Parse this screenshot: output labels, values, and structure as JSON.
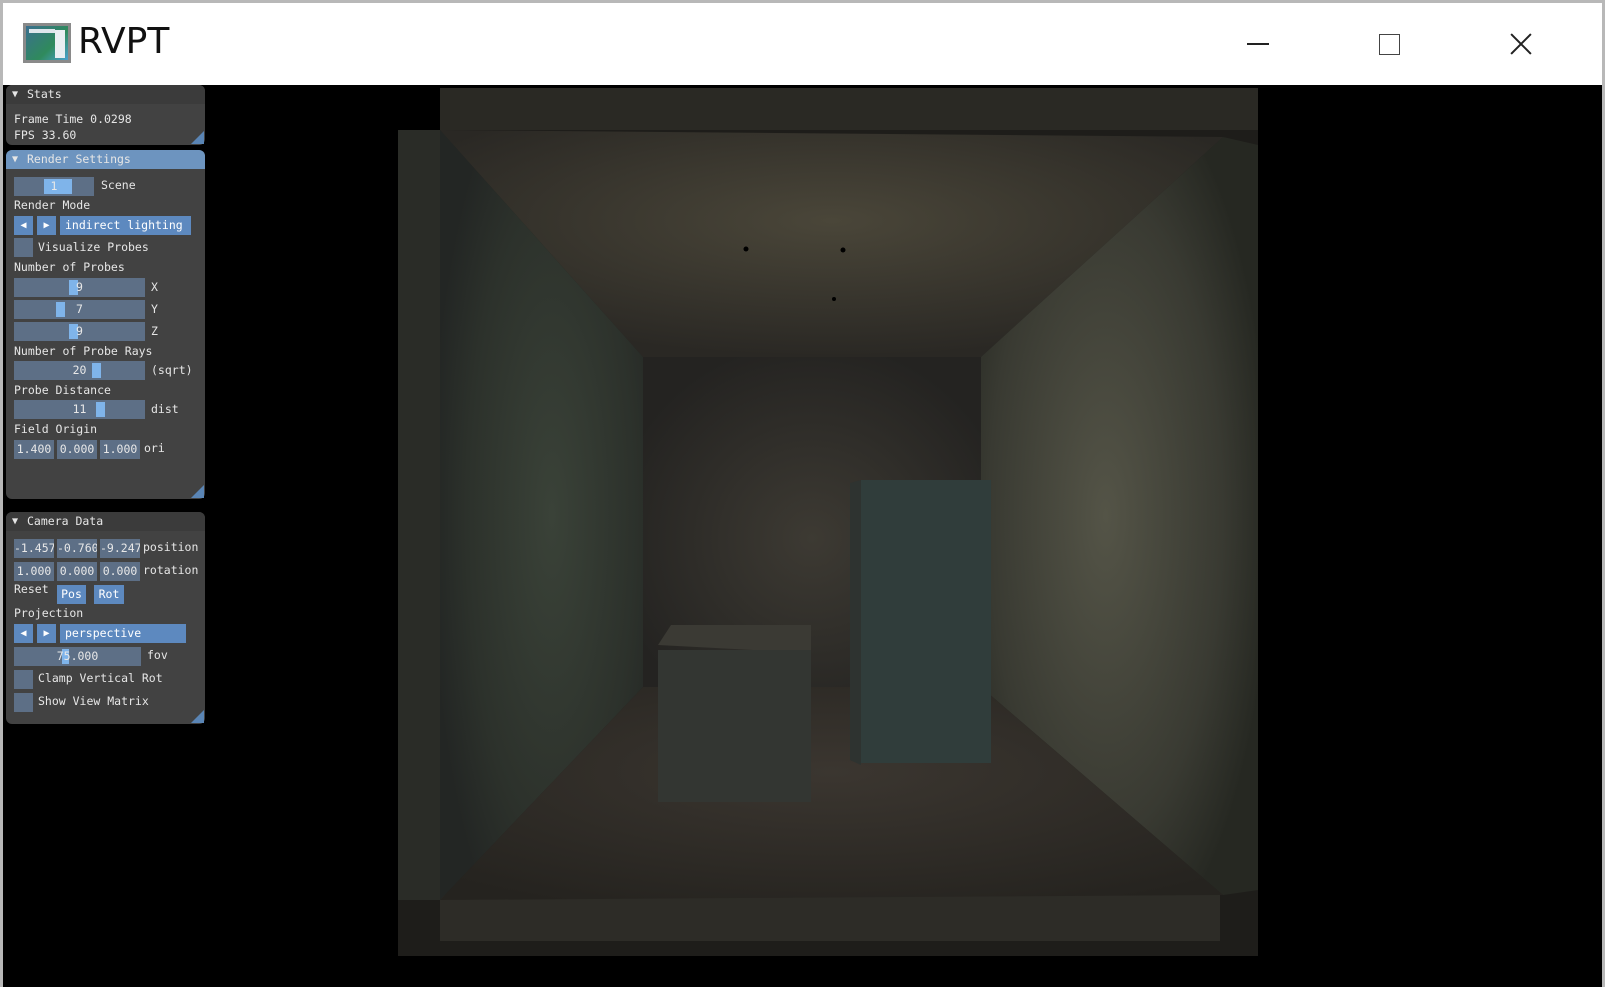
{
  "window": {
    "title": "RVPT",
    "icon": "app-window-icon"
  },
  "stats": {
    "header": "Stats",
    "frame_time": "Frame Time 0.0298",
    "fps": "FPS 33.60"
  },
  "render_settings": {
    "header": "Render Settings",
    "scene_value": "1",
    "scene_label": "Scene",
    "render_mode_label": "Render Mode",
    "render_mode_value": "indirect lighting",
    "visualize_probes_label": "Visualize Probes",
    "visualize_probes_checked": false,
    "num_probes_label": "Number of Probes",
    "probes_x": "9",
    "probes_x_label": "X",
    "probes_y": "7",
    "probes_y_label": "Y",
    "probes_z": "9",
    "probes_z_label": "Z",
    "num_rays_label": "Number of Probe Rays",
    "rays_value": "20",
    "rays_suffix": "(sqrt)",
    "probe_distance_label": "Probe Distance",
    "distance_value": "11",
    "distance_suffix": "dist",
    "field_origin_label": "Field Origin",
    "origin": [
      "1.400",
      "0.000",
      "1.000"
    ],
    "origin_suffix": "ori"
  },
  "camera": {
    "header": "Camera Data",
    "position": [
      "-1.457",
      "-0.760",
      "-9.247"
    ],
    "position_label": "position",
    "rotation": [
      "1.000",
      "0.000",
      "0.000"
    ],
    "rotation_label": "rotation",
    "reset_label": "Reset",
    "reset_pos": "Pos",
    "reset_rot": "Rot",
    "projection_label": "Projection",
    "projection_value": "perspective",
    "fov_value": "75.000",
    "fov_label": "fov",
    "clamp_label": "Clamp Vertical Rot",
    "clamp_checked": false,
    "view_matrix_label": "Show View Matrix",
    "view_matrix_checked": false
  },
  "colors": {
    "panel_bg": "#454545",
    "header_active": "#6d94bf",
    "field_bg": "#5d6f86",
    "button_bg": "#5d89bf",
    "slider_grab": "#7fb4ea"
  }
}
